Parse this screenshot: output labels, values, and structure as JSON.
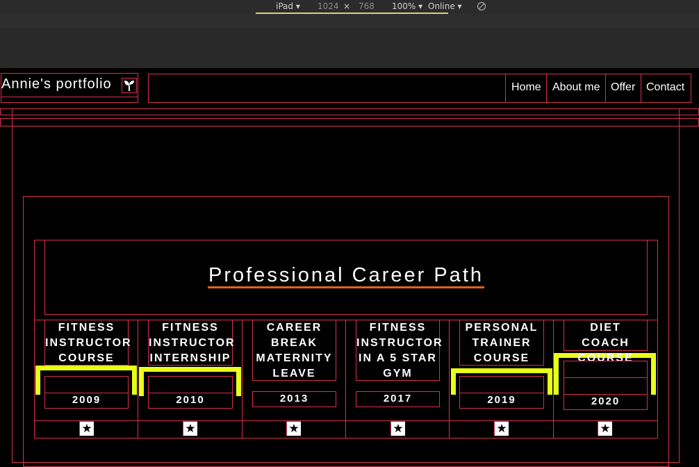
{
  "devtools": {
    "device": "iPad ▾",
    "width": "1024",
    "times": "×",
    "height": "768",
    "zoom": "100% ▾",
    "network": "Online ▾",
    "rotate_icon": "rotate-icon"
  },
  "header": {
    "logo_text": "Annie's portfolio",
    "logo_icon": "sprout-icon",
    "nav": [
      "Home",
      "About me",
      "Offer",
      "Contact"
    ]
  },
  "section": {
    "title": "Professional Career Path"
  },
  "timeline": [
    {
      "label": "FITNESS INSTRUCTOR COURSE",
      "year": "2009",
      "highlight": true
    },
    {
      "label": "FITNESS INSTRUCTOR INTERNSHIP",
      "year": "2010",
      "highlight": true
    },
    {
      "label": "CAREER BREAK MATERNITY LEAVE",
      "year": "2013",
      "highlight": false
    },
    {
      "label": "FITNESS INSTRUCTOR IN A 5 STAR GYM",
      "year": "2017",
      "highlight": false
    },
    {
      "label": "PERSONAL TRAINER COURSE",
      "year": "2019",
      "highlight": true
    },
    {
      "label": "DIET COACH COURSE",
      "year": "2020",
      "highlight": true
    }
  ],
  "colors": {
    "outline": "#d9304f",
    "highlight": "#e9ff1a",
    "title_underline": "#e0641a"
  }
}
